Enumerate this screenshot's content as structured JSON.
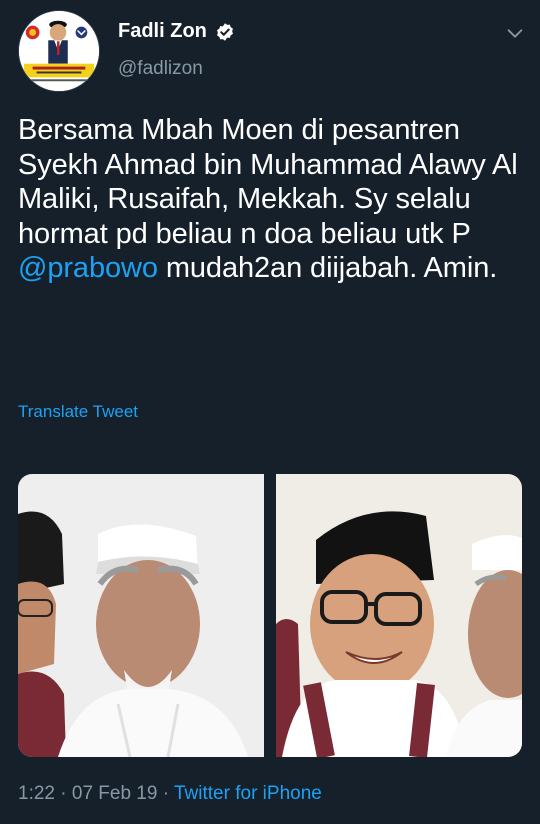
{
  "author": {
    "display_name": "Fadli Zon",
    "handle": "@fadlizon",
    "verified": true,
    "avatar_caption": "Dr. H. FADLI ZON, S.S., M.Sc."
  },
  "tweet": {
    "text_before_mention": "Bersama Mbah Moen di pesantren Syekh Ahmad bin Muhammad Alawy Al Maliki, Rusaifah, Mekkah. Sy selalu hormat pd beliau n doa beliau utk P ",
    "mention": "@prabowo",
    "text_after_mention": " mudah2an diijabah. Amin.",
    "translate_label": "Translate Tweet"
  },
  "footer": {
    "time": "1:22",
    "separator": " · ",
    "date": "07 Feb 19",
    "source": "Twitter for iPhone"
  },
  "colors": {
    "background": "#15202b",
    "link": "#1da1f2",
    "secondary_text": "#8899a6",
    "primary_text": "#ffffff"
  },
  "icons": {
    "verified": "verified-badge-icon",
    "menu": "chevron-down-icon"
  }
}
